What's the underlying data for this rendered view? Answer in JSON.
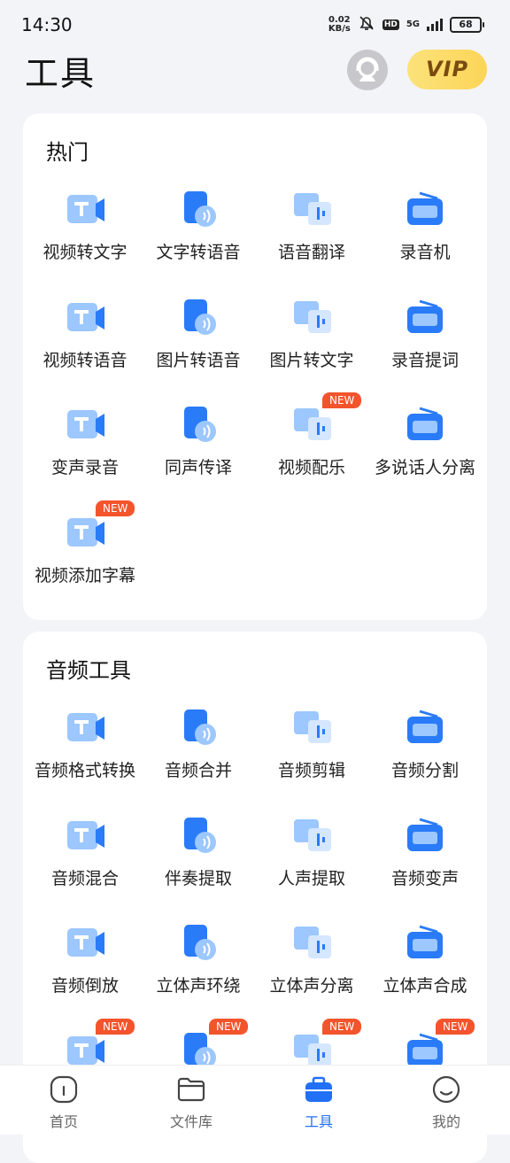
{
  "status_bar": {
    "time": "14:30",
    "net_speed_value": "0.02",
    "net_speed_unit": "KB/s",
    "hd": "HD",
    "network": "5G",
    "battery": "68"
  },
  "header": {
    "title": "工具",
    "vip_label": "VIP"
  },
  "sections": [
    {
      "title": "热门",
      "tools": [
        {
          "label": "视频转文字",
          "icon": "video-to-text-icon"
        },
        {
          "label": "文字转语音",
          "icon": "text-to-speech-icon"
        },
        {
          "label": "语音翻译",
          "icon": "voice-translate-icon"
        },
        {
          "label": "录音机",
          "icon": "recorder-icon"
        },
        {
          "label": "视频转语音",
          "icon": "video-to-audio-icon"
        },
        {
          "label": "图片转语音",
          "icon": "image-to-speech-icon"
        },
        {
          "label": "图片转文字",
          "icon": "image-to-text-icon"
        },
        {
          "label": "录音提词",
          "icon": "recording-prompter-icon"
        },
        {
          "label": "变声录音",
          "icon": "voice-change-record-icon"
        },
        {
          "label": "同声传译",
          "icon": "simultaneous-interpretation-icon"
        },
        {
          "label": "视频配乐",
          "icon": "video-music-icon",
          "badge": "NEW"
        },
        {
          "label": "多说话人分离",
          "icon": "speaker-separation-icon"
        },
        {
          "label": "视频添加字幕",
          "icon": "video-subtitles-icon",
          "badge": "NEW"
        }
      ]
    },
    {
      "title": "音频工具",
      "tools": [
        {
          "label": "音频格式转换",
          "icon": "audio-format-convert-icon"
        },
        {
          "label": "音频合并",
          "icon": "audio-merge-icon"
        },
        {
          "label": "音频剪辑",
          "icon": "audio-cut-icon"
        },
        {
          "label": "音频分割",
          "icon": "audio-split-icon"
        },
        {
          "label": "音频混合",
          "icon": "audio-mix-icon"
        },
        {
          "label": "伴奏提取",
          "icon": "accompaniment-extract-icon"
        },
        {
          "label": "人声提取",
          "icon": "vocal-extract-icon"
        },
        {
          "label": "音频变声",
          "icon": "audio-voice-change-icon"
        },
        {
          "label": "音频倒放",
          "icon": "audio-reverse-icon"
        },
        {
          "label": "立体声环绕",
          "icon": "stereo-surround-icon"
        },
        {
          "label": "立体声分离",
          "icon": "stereo-separate-icon"
        },
        {
          "label": "立体声合成",
          "icon": "stereo-compose-icon"
        },
        {
          "label": "",
          "icon": "audio-zip-icon",
          "badge": "NEW"
        },
        {
          "label": "",
          "icon": "audio-equalizer-icon",
          "badge": "NEW"
        },
        {
          "label": "",
          "icon": "audio-broadcast-icon",
          "badge": "NEW"
        },
        {
          "label": "",
          "icon": "audio-wave-icon",
          "badge": "NEW"
        }
      ]
    }
  ],
  "bottom_nav": [
    {
      "label": "首页",
      "icon": "home-icon"
    },
    {
      "label": "文件库",
      "icon": "folder-icon"
    },
    {
      "label": "工具",
      "icon": "toolbox-icon",
      "active": true
    },
    {
      "label": "我的",
      "icon": "profile-smile-icon"
    }
  ],
  "colors": {
    "accent": "#2270f6",
    "icon_light": "#9cc7ff",
    "badge": "#f4542c",
    "vip": "#fcd558"
  }
}
